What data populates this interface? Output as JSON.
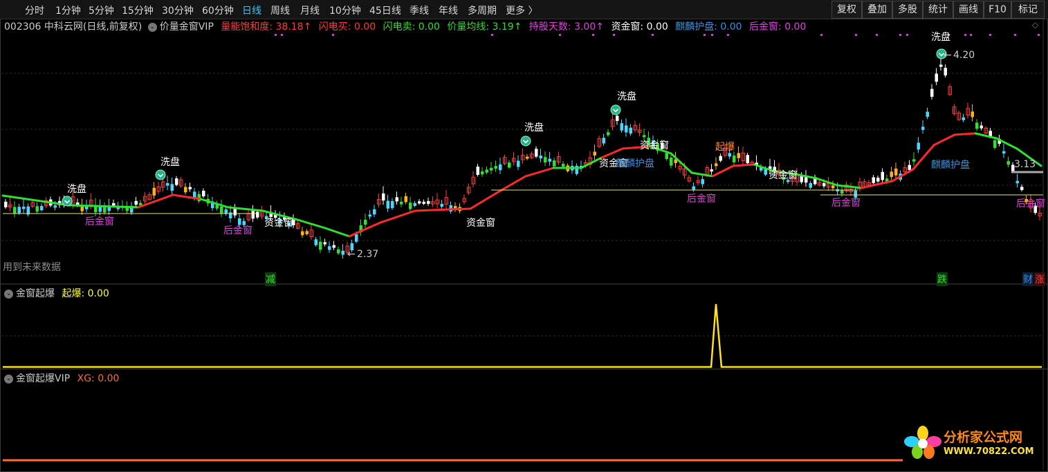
{
  "toolbar": {
    "periods": [
      "分时",
      "1分钟",
      "5分钟",
      "15分钟",
      "30分钟",
      "60分钟",
      "日线",
      "周线",
      "月线",
      "10分钟",
      "45日线",
      "季线",
      "年线",
      "多周期",
      "更多 〉"
    ],
    "active_period": "日线",
    "buttons": [
      "复权",
      "叠加",
      "多股",
      "统计",
      "画线",
      "F10",
      "标记"
    ]
  },
  "main_panel": {
    "stock_title": "002306 中科云网(日线,前复权)",
    "indicator_name": "价量金窗VIP",
    "values": [
      {
        "label": "量能饱和度: 38.18↑",
        "color": "#ff3b3b"
      },
      {
        "label": "闪电买: 0.00",
        "color": "#ff3b3b"
      },
      {
        "label": "闪电卖: 0.00",
        "color": "#33dd33"
      },
      {
        "label": "价量均线: 3.19↑",
        "color": "#33dd33"
      },
      {
        "label": "持股天数: 3.00↑",
        "color": "#e040e0"
      },
      {
        "label": "资金窗: 0.00",
        "color": "#ffffff"
      },
      {
        "label": "麒麟护盘: 0.00",
        "color": "#3a8fe0"
      },
      {
        "label": "后金窗: 0.00",
        "color": "#e040e0"
      }
    ],
    "future_data_note": "用到未来数据",
    "price_high": "4.20",
    "price_low": "2.37",
    "price_last": "3.13",
    "annotations": {
      "wash": "洗盘",
      "fund_window": "资金窗",
      "after_window": "后金窗",
      "explode": "起爆",
      "qilin": "麒麟护盘"
    },
    "badges": [
      {
        "text": "减",
        "color": "#33dd33"
      },
      {
        "text": "跌",
        "color": "#33dd33"
      },
      {
        "text": "财",
        "color": "#3a8fe0"
      },
      {
        "text": "涨",
        "color": "#ff3b3b"
      }
    ]
  },
  "panel2": {
    "name": "金窗起爆",
    "value_label": "起爆: 0.00",
    "color": "#ffff33"
  },
  "panel3": {
    "name": "金窗起爆VIP",
    "value_label": "XG: 0.00",
    "color": "#ff6a3a"
  },
  "watermark": {
    "line1": "分析家公式网",
    "line2": "WWW.70822.COM"
  }
}
